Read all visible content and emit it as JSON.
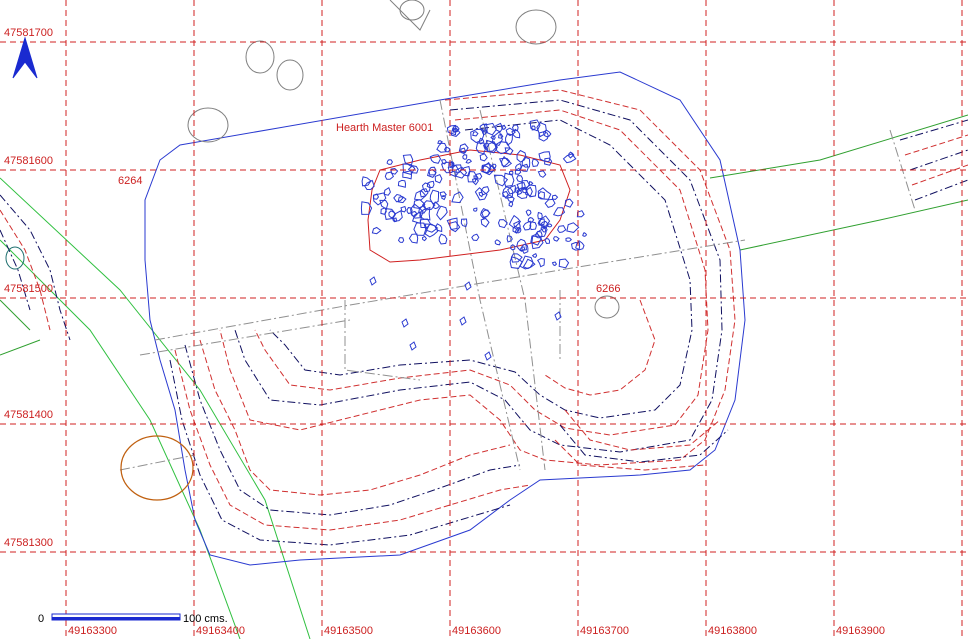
{
  "map": {
    "colors": {
      "grid": "#d02020",
      "trench_outline": "#2a3ad0",
      "hearth_stones": "#2a3ad0",
      "contour_red": "#d03030",
      "contour_dark": "#101060",
      "section_green": "#30a030",
      "feature_orange": "#c06010",
      "stones_grey": "#808080",
      "teal_feature": "#207070"
    },
    "grid_labels": {
      "y": [
        "47581700",
        "47581600",
        "47581500",
        "47581400",
        "47581300"
      ],
      "x": [
        "49163300",
        "49163400",
        "49163500",
        "49163600",
        "49163700",
        "49163800",
        "49163900"
      ]
    },
    "feature_labels": {
      "hearth": "Hearth Master 6001",
      "context_left": "6264",
      "context_right": "6266"
    },
    "scale_bar": {
      "start_label": "0",
      "end_label": "100 cms."
    },
    "north_arrow": "north-arrow"
  }
}
